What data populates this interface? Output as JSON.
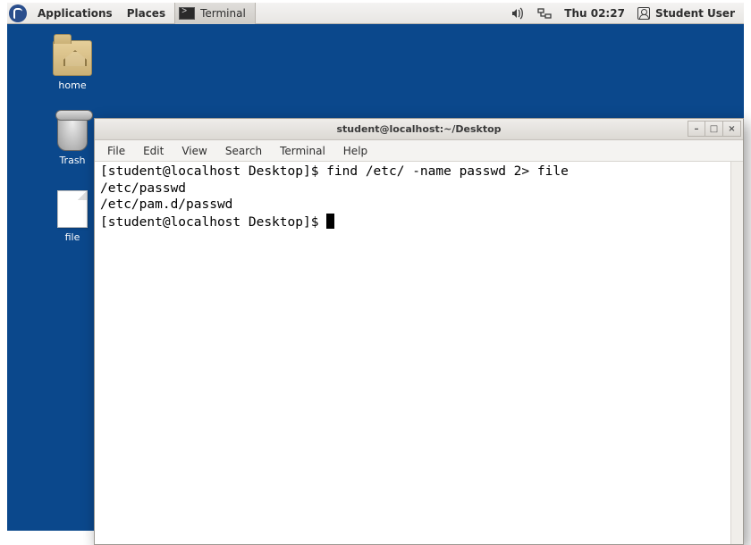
{
  "panel": {
    "menus": {
      "applications": "Applications",
      "places": "Places"
    },
    "taskbar": {
      "terminal_label": "Terminal"
    },
    "clock": "Thu 02:27",
    "user": "Student User"
  },
  "desktop": {
    "home": "home",
    "trash": "Trash",
    "file": "file"
  },
  "window": {
    "title": "student@localhost:~/Desktop",
    "menus": {
      "file": "File",
      "edit": "Edit",
      "view": "View",
      "search": "Search",
      "terminal": "Terminal",
      "help": "Help"
    },
    "buttons": {
      "min": "–",
      "max": "□",
      "close": "×"
    }
  },
  "terminal": {
    "prompt1": "[student@localhost Desktop]$ ",
    "cmd1": "find /etc/ -name passwd 2> file",
    "out1": "/etc/passwd",
    "out2": "/etc/pam.d/passwd",
    "prompt2": "[student@localhost Desktop]$ "
  }
}
